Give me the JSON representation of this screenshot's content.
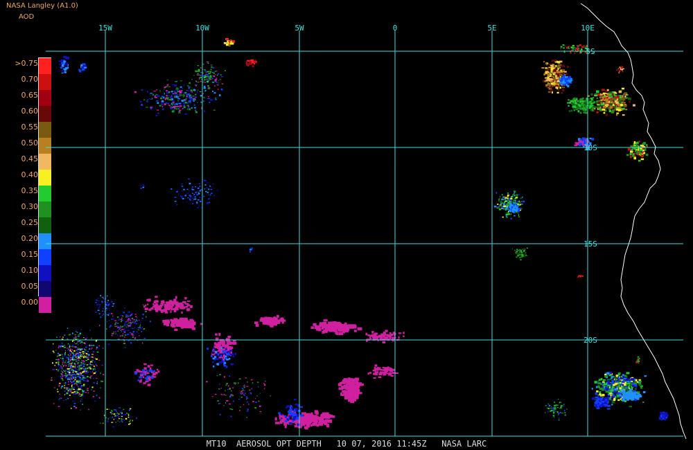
{
  "header": {
    "title": "NASA Langley (A1.0)",
    "product": "AOD"
  },
  "legend": {
    "labels": [
      ">0.75",
      "0.70",
      "0.65",
      "0.60",
      "0.55",
      "0.50",
      "0.45",
      "0.40",
      "0.35",
      "0.30",
      "0.25",
      "0.20",
      "0.15",
      "0.10",
      "0.05",
      "0.00"
    ],
    "colors": [
      "#ff2020",
      "#cc1010",
      "#a00010",
      "#6a0808",
      "#7a5a10",
      "#b88020",
      "#f0b860",
      "#f8f020",
      "#20cc30",
      "#209020",
      "#106010",
      "#2090ff",
      "#1040ff",
      "#1010c0",
      "#100870",
      "#d020a0"
    ]
  },
  "map": {
    "longitude_labels": [
      "15W",
      "10W",
      "5W",
      "0",
      "5E",
      "10E"
    ],
    "latitude_labels": [
      "5S",
      "10S",
      "15S",
      "20S"
    ],
    "gridline_color": "#40e0e0",
    "coastline_color": "#ffffff"
  },
  "footer": {
    "caption": "MT10  AEROSOL OPT DEPTH   10 07, 2016 11:45Z   NASA LARC"
  }
}
